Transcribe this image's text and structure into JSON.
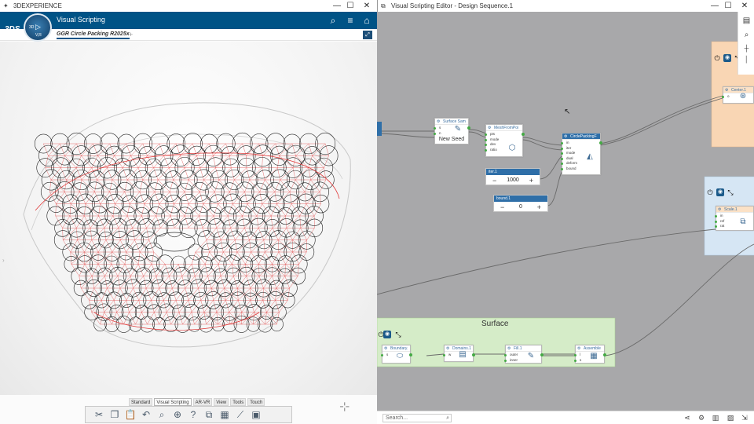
{
  "left_window": {
    "title": "3DEXPERIENCE",
    "app_name": "Visual Scripting",
    "tab_title": "GGR Circle Packing R2025x",
    "compass_labels": {
      "top": "3D",
      "bottom": "V,R"
    },
    "logo": "3DS",
    "section_tabs": [
      "Standard",
      "Visual Scripting",
      "AR-VR",
      "View",
      "Tools",
      "Touch"
    ],
    "active_section": "Visual Scripting",
    "win_controls": [
      "—",
      "☐",
      "✕"
    ]
  },
  "right_window": {
    "title": "Visual Scripting Editor - Design Sequence.1",
    "win_controls": [
      "—",
      "☐",
      "✕"
    ],
    "search_placeholder": "Search...",
    "surface_zone_title": "Surface",
    "nodes": {
      "surface_sampler": {
        "title": "Surface Sam",
        "pins": [
          "s",
          "n"
        ],
        "label": "New Seed"
      },
      "mesh_from_points": {
        "title": "MeshFromPoi",
        "pins": [
          "pts",
          "mode",
          "dev",
          "ratio"
        ]
      },
      "circle_packing": {
        "title": "CirclePackingF",
        "pins": [
          "in",
          "iter",
          "mode",
          "dual",
          "deform",
          "bound"
        ]
      },
      "center": {
        "title": "Center.1",
        "pins": [
          "o"
        ]
      },
      "scale": {
        "title": "Scale.1",
        "pins": [
          "in",
          "ref",
          "rat"
        ]
      },
      "boundary": {
        "title": "Boundary.",
        "pins": [
          "s"
        ]
      },
      "domains": {
        "title": "Domains.1",
        "pins": [
          "w"
        ]
      },
      "fill": {
        "title": "Fill.1",
        "pins": [
          "outer",
          "inner"
        ]
      },
      "assemble": {
        "title": "Assemble",
        "pins": [
          "l",
          "s"
        ]
      }
    },
    "iter_param": {
      "name": "iter.1",
      "value": "1000",
      "minus": "−",
      "plus": "+"
    },
    "bound_param": {
      "name": "bound.1",
      "value": "0",
      "minus": "−",
      "plus": "+"
    }
  },
  "colors": {
    "app_blue": "#005386",
    "canvas_grey": "#a8a8aa",
    "surface_zone_green": "#d5ecc8",
    "orange_zone": "#f9d6b4",
    "blue_zone": "#d6e6f4",
    "pin_green": "#44aa44",
    "mesh_red": "#e03a3a"
  },
  "icons": {
    "search": "search-icon",
    "menu": "hamburger-icon",
    "tag": "tag-icon",
    "power": "power-icon",
    "eye": "eye-icon",
    "collapse": "collapse-icon"
  }
}
